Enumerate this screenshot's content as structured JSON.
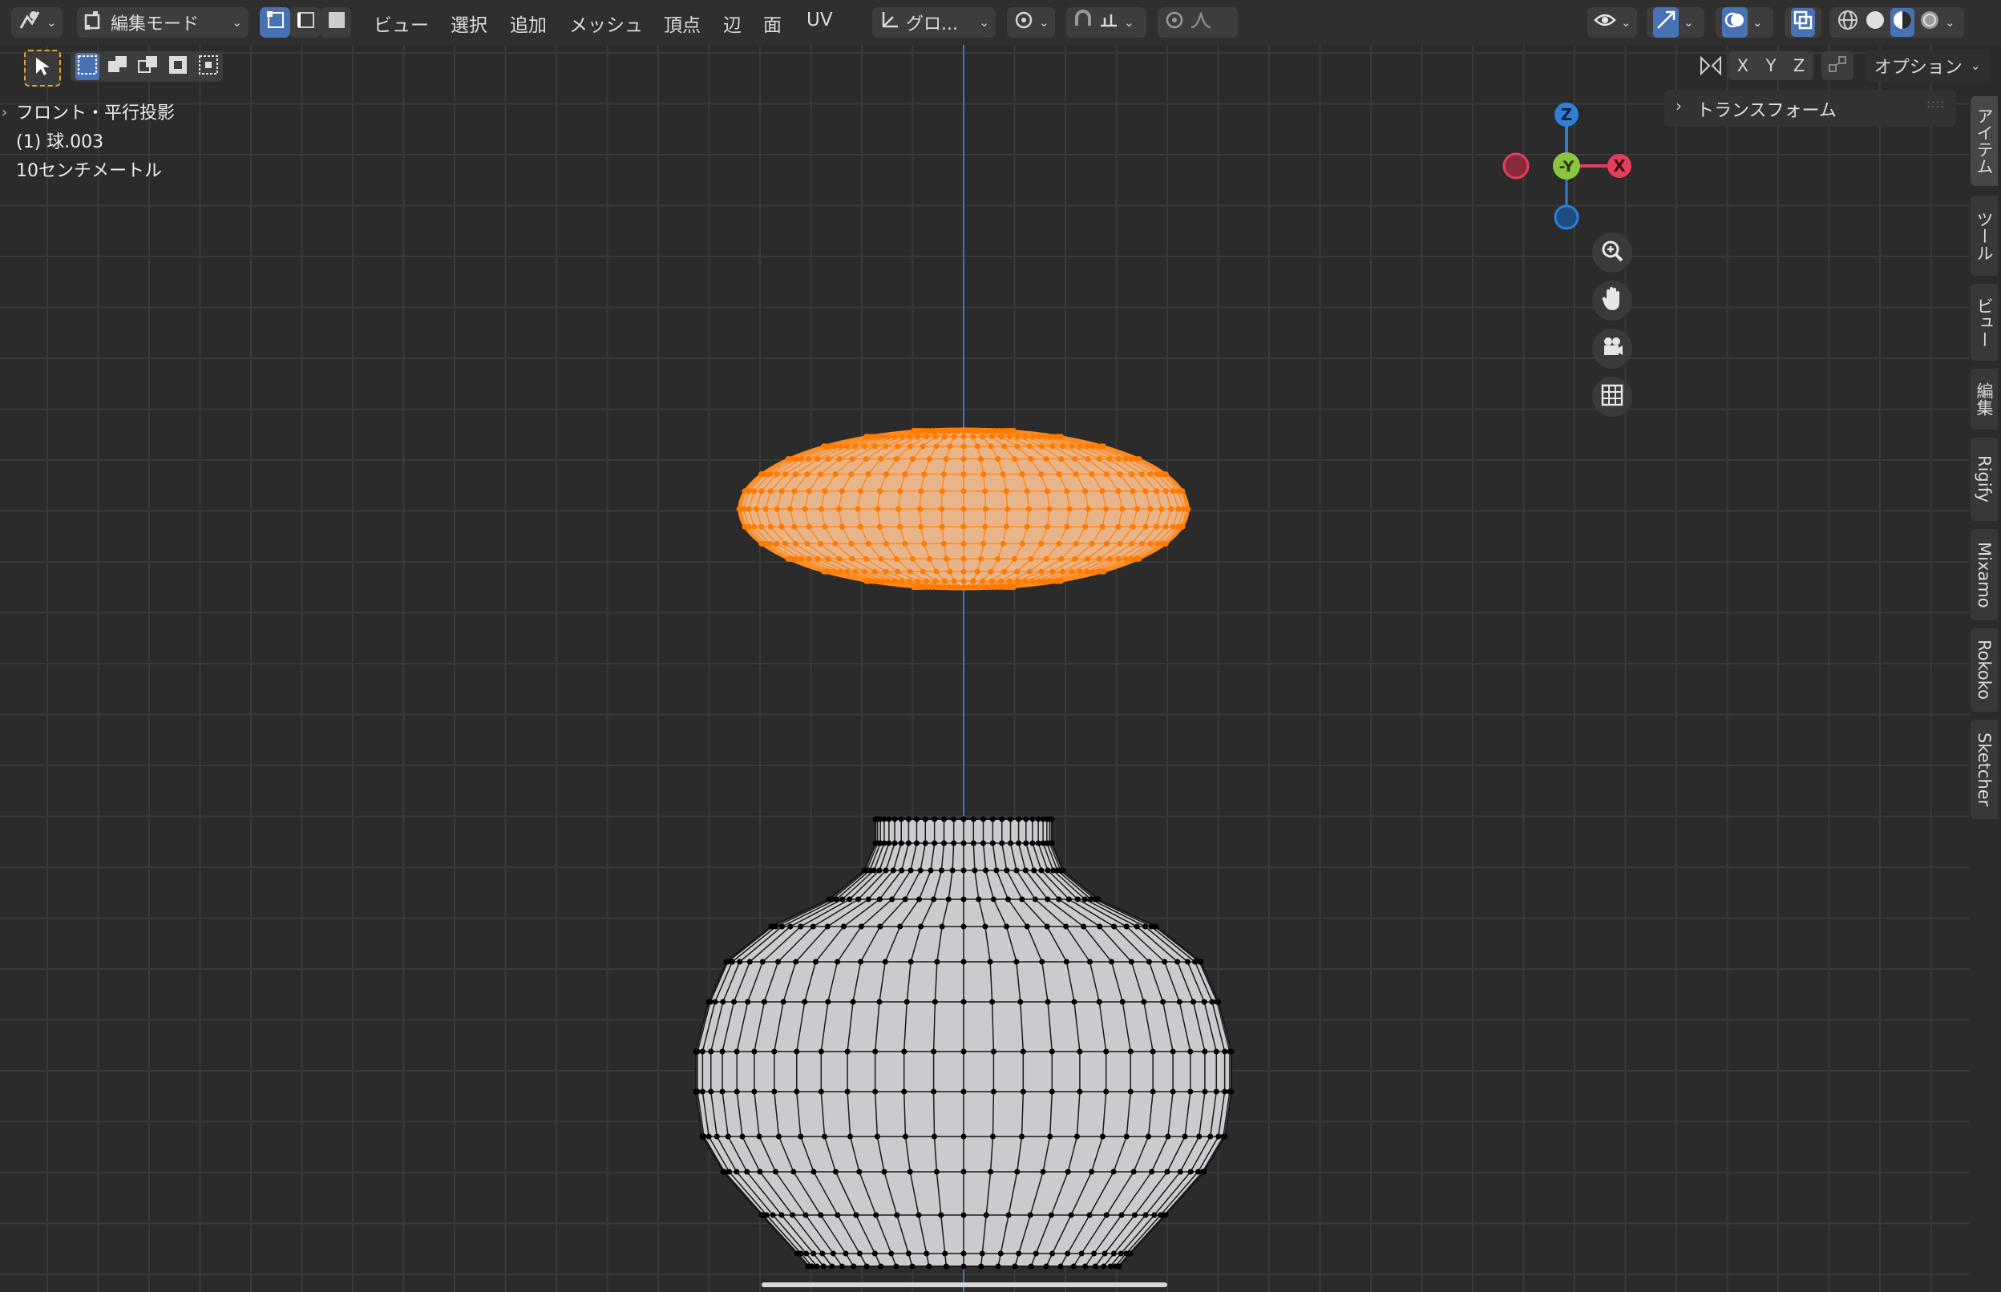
{
  "header": {
    "mode_label": "編集モード",
    "menus": [
      "ビュー",
      "選択",
      "追加",
      "メッシュ",
      "頂点",
      "辺",
      "面",
      "UV"
    ],
    "transform_orientation": "グロ...",
    "options_label": "オプション",
    "axis_x": "X",
    "axis_y": "Y",
    "axis_z": "Z"
  },
  "viewport": {
    "view_name": "フロント・平行投影",
    "object_name": "(1) 球.003",
    "scale_label": "10センチメートル"
  },
  "gizmo": {
    "z_label": "Z",
    "neg_y_label": "-Y",
    "x_label": "X",
    "colors": {
      "x": "#e33e5a",
      "y": "#8bc53f",
      "z": "#2e7fd8"
    }
  },
  "npanel": {
    "section": "トランスフォーム"
  },
  "sidetabs": [
    "アイテム",
    "ツール",
    "ビュー",
    "編集",
    "Rigify",
    "Mixamo",
    "Rokoko",
    "Sketcher"
  ],
  "colors": {
    "selected": "#ff8a1e",
    "accent": "#4772b3",
    "grid": "#3a3a3a"
  }
}
